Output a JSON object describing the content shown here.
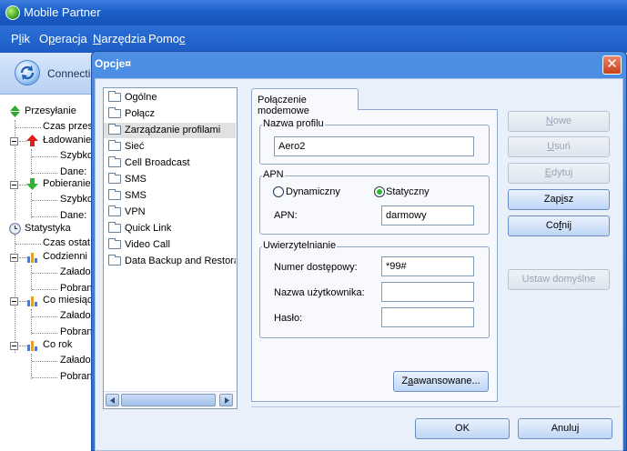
{
  "app": {
    "title": "Mobile Partner"
  },
  "menu": [
    {
      "pre": "P",
      "acc": "l",
      "post": "ik"
    },
    {
      "pre": "O",
      "acc": "p",
      "post": "eracja"
    },
    {
      "pre": "",
      "acc": "N",
      "post": "arzędzia"
    },
    {
      "pre": "Pomo",
      "acc": "c",
      "post": ""
    }
  ],
  "toolbar": {
    "connect_label": "Connecti"
  },
  "tree": {
    "przesylanie": "Przesyłanie",
    "czas_przes": "Czas przes",
    "ladowanie": "Ładowanie",
    "szybko1": "Szybko",
    "dane1": "Dane:",
    "pobieranie": "Pobieranie",
    "szybko2": "Szybko",
    "dane2": "Dane:",
    "statystyka": "Statystyka",
    "czas_ostat": "Czas ostat",
    "codziennie": "Codzienni",
    "zalado1": "Załado",
    "pobran1": "Pobran",
    "co_miesiac": "Co miesiąc",
    "zalado2": "Załado",
    "pobran2": "Pobran",
    "co_rok": "Co rok",
    "zalado3": "Załado",
    "pobran3": "Pobran"
  },
  "dialog": {
    "title": "Opcje¤",
    "close_symbol": "✕",
    "categories": [
      "Ogólne",
      "Połącz",
      "Zarządzanie profilami",
      "Sieć",
      "Cell Broadcast",
      "SMS",
      "SMS",
      "VPN",
      "Quick Link",
      "Video Call",
      "Data Backup and Restora"
    ],
    "selected_category": "Zarządzanie profilami",
    "tab_label": "Połączenie modemowe",
    "profile_group": "Nazwa profilu",
    "profile_value": "Aero2",
    "apn_group": "APN",
    "radio_dynamic": "Dynamiczny",
    "radio_static": "Statyczny",
    "apn_label": "APN:",
    "apn_value": "darmowy",
    "auth_group": "Uwierzytelnianie",
    "number_label": "Numer dostępowy:",
    "number_value": "*99#",
    "user_label": "Nazwa użytkownika:",
    "user_value": "",
    "password_label": "Hasło:",
    "password_value": "",
    "advanced": {
      "pre": "Z",
      "acc": "a",
      "post": "awansowane..."
    },
    "side_buttons": {
      "new": {
        "pre": "",
        "acc": "N",
        "post": "owe"
      },
      "delete": {
        "pre": "",
        "acc": "U",
        "post": "suń"
      },
      "edit": {
        "pre": "",
        "acc": "E",
        "post": "dytuj"
      },
      "save": {
        "pre": "Zap",
        "acc": "i",
        "post": "sz"
      },
      "undo": {
        "pre": "Co",
        "acc": "f",
        "post": "nij"
      },
      "default": "Ustaw domyślne"
    },
    "ok": "OK",
    "cancel": "Anuluj"
  }
}
